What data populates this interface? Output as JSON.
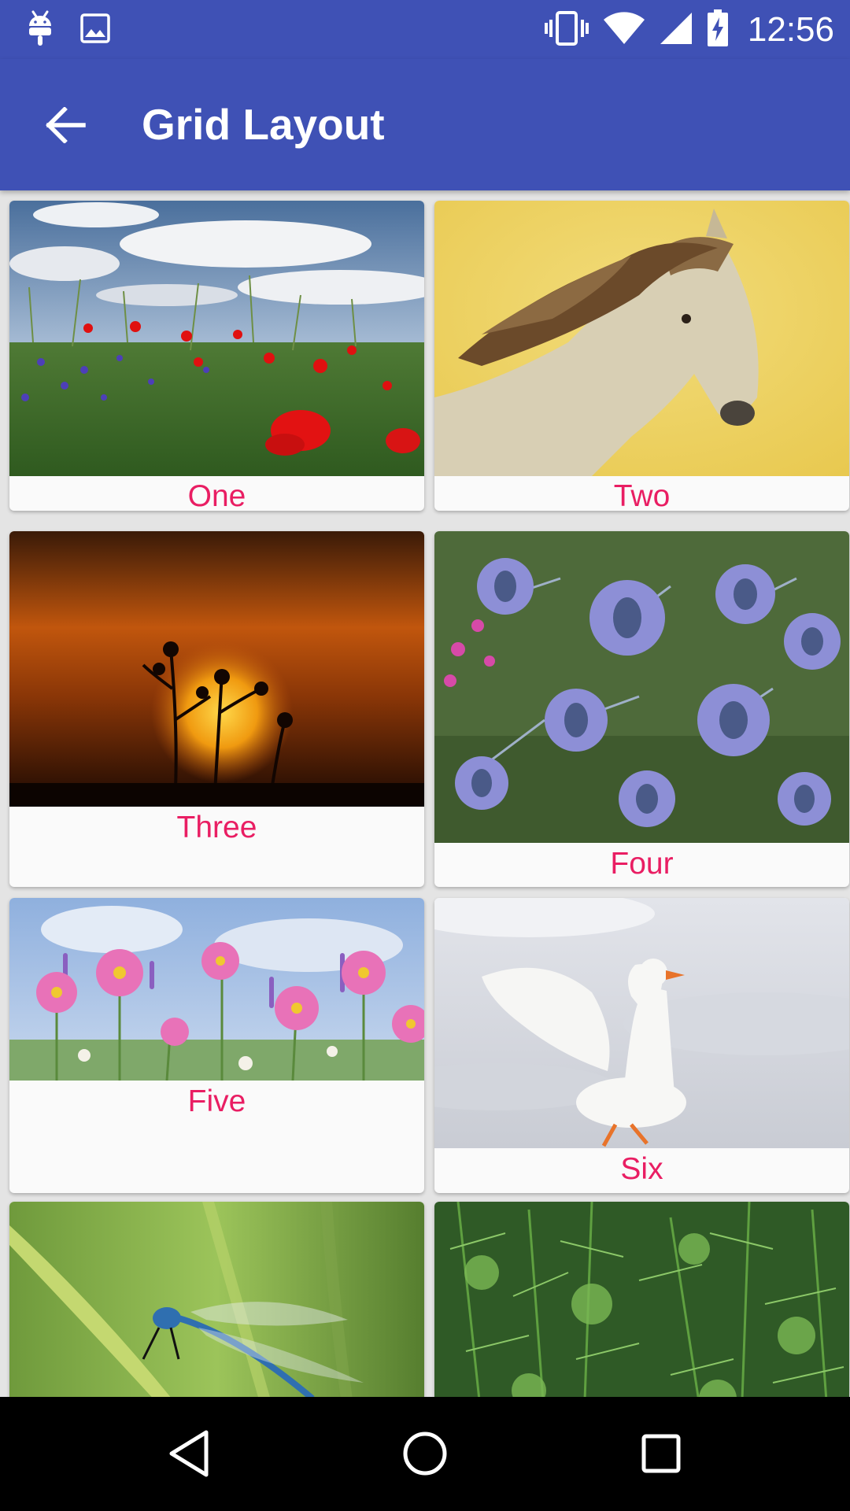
{
  "status_bar": {
    "time": "12:56",
    "left_icons": [
      "android-icon",
      "image-icon"
    ],
    "right_icons": [
      "vibrate-icon",
      "wifi-icon",
      "cell-signal-icon",
      "battery-charging-icon"
    ]
  },
  "app_bar": {
    "title": "Grid Layout",
    "background": "#3f51b5"
  },
  "grid": {
    "caption_color": "#e91e63",
    "items": [
      {
        "label": "One",
        "image": "poppy-field-photo"
      },
      {
        "label": "Two",
        "image": "horse-photo"
      },
      {
        "label": "Three",
        "image": "sunset-photo"
      },
      {
        "label": "Four",
        "image": "thistle-flowers-photo"
      },
      {
        "label": "Five",
        "image": "cosmos-flowers-photo"
      },
      {
        "label": "Six",
        "image": "goose-in-snow-photo"
      },
      {
        "label": "",
        "image": "dragonfly-photo"
      },
      {
        "label": "",
        "image": "pine-branches-photo"
      }
    ]
  },
  "nav_bar": {
    "buttons": [
      "back-triangle-icon",
      "home-circle-icon",
      "recents-square-icon"
    ]
  }
}
